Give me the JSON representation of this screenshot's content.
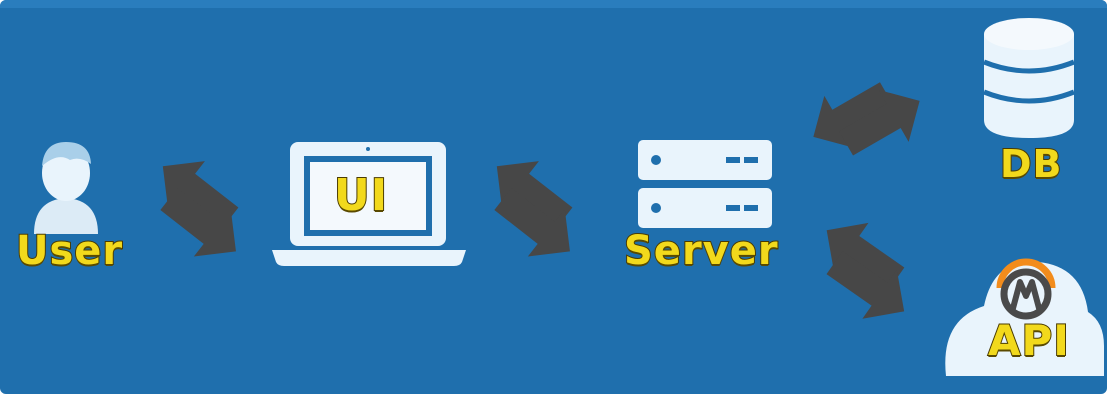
{
  "colors": {
    "background": "#1f6fad",
    "icon": "#e9f4fc",
    "icon_shadow": "#a9cfe9",
    "arrow": "#474747",
    "label": "#f2d91c",
    "label_outline": "#4a3b00",
    "logo_accent": "#f28c1c"
  },
  "nodes": {
    "user": {
      "label": "User",
      "icon": "user-icon"
    },
    "ui": {
      "label": "UI",
      "icon": "laptop-icon"
    },
    "server": {
      "label": "Server",
      "icon": "server-icon"
    },
    "db": {
      "label": "DB",
      "icon": "database-icon"
    },
    "api": {
      "label": "API",
      "icon": "cloud-icon"
    }
  },
  "connections": [
    {
      "from": "User",
      "to": "UI",
      "direction": "bidirectional"
    },
    {
      "from": "UI",
      "to": "Server",
      "direction": "bidirectional"
    },
    {
      "from": "Server",
      "to": "DB",
      "direction": "bidirectional"
    },
    {
      "from": "Server",
      "to": "API",
      "direction": "bidirectional"
    }
  ]
}
